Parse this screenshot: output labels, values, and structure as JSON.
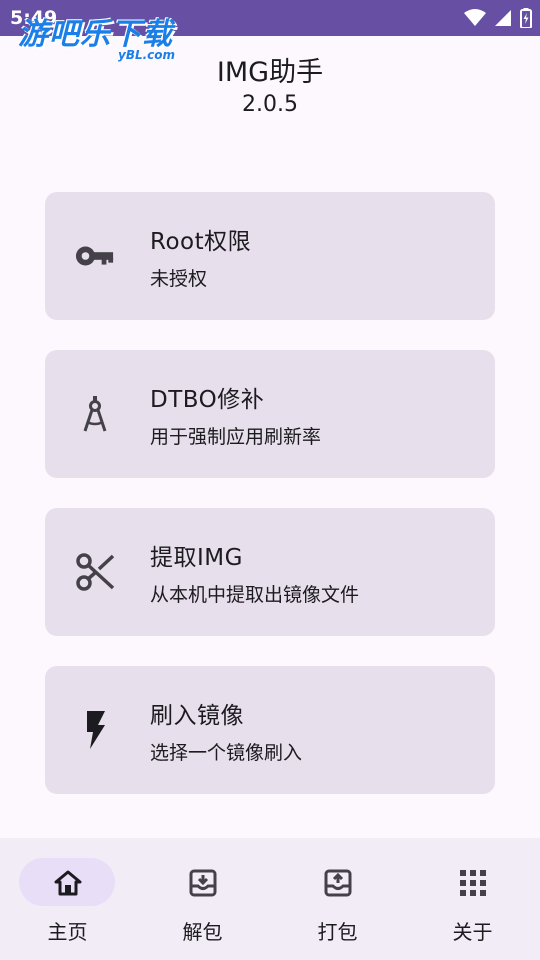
{
  "status_bar": {
    "time": "5:49",
    "icons": [
      "wifi-icon",
      "signal-icon",
      "battery-icon"
    ]
  },
  "watermark": {
    "main": "游吧乐下载",
    "sub": "yBL.com"
  },
  "header": {
    "title": "IMG助手",
    "version": "2.0.5"
  },
  "cards": [
    {
      "icon": "key-icon",
      "title": "Root权限",
      "subtitle": "未授权"
    },
    {
      "icon": "compass-icon",
      "title": "DTBO修补",
      "subtitle": "用于强制应用刷新率"
    },
    {
      "icon": "scissors-icon",
      "title": "提取IMG",
      "subtitle": "从本机中提取出镜像文件"
    },
    {
      "icon": "flash-icon",
      "title": "刷入镜像",
      "subtitle": "选择一个镜像刷入"
    }
  ],
  "bottom_nav": {
    "active_index": 0,
    "items": [
      {
        "icon": "home-icon",
        "label": "主页"
      },
      {
        "icon": "unpack-icon",
        "label": "解包"
      },
      {
        "icon": "pack-icon",
        "label": "打包"
      },
      {
        "icon": "apps-grid-icon",
        "label": "关于"
      }
    ]
  },
  "colors": {
    "status_bar": "#6750a4",
    "card_bg": "#e7e0ec",
    "nav_bg": "#f2ecf6",
    "active_pill": "#e8def8",
    "text": "#1c1b1f"
  }
}
